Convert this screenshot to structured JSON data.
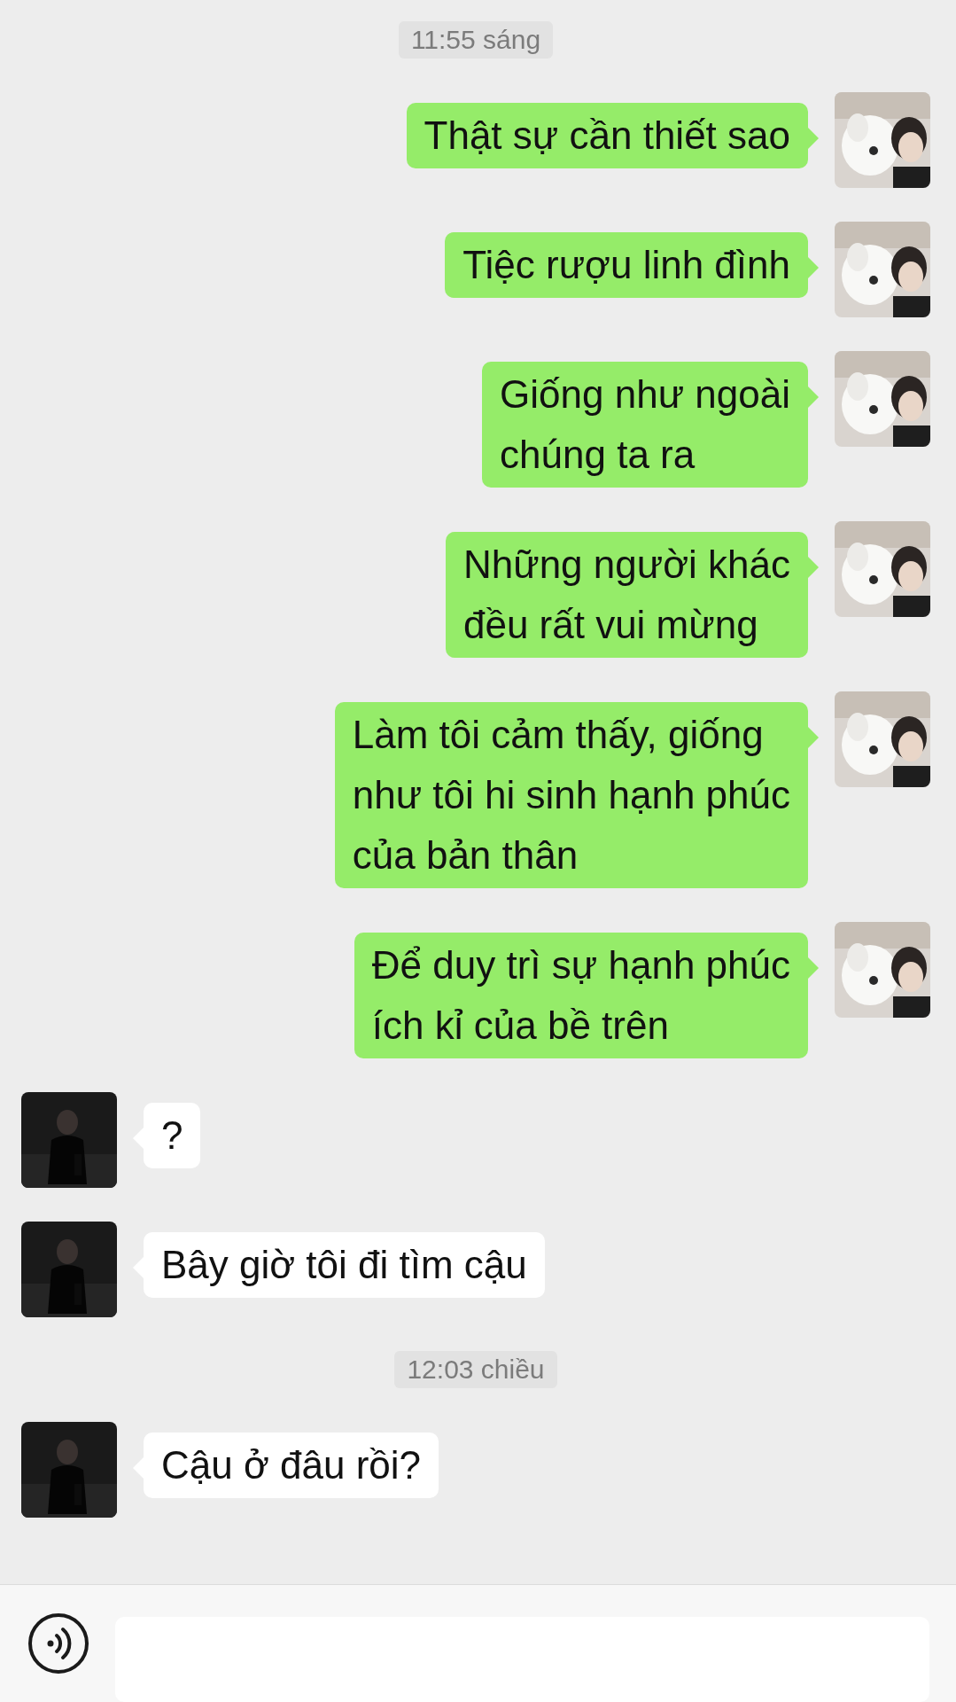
{
  "messages": [
    {
      "kind": "time",
      "text": "11:55 sáng"
    },
    {
      "kind": "message",
      "outgoing": true,
      "text": "Thật sự cần thiết sao"
    },
    {
      "kind": "message",
      "outgoing": true,
      "text": "Tiệc rượu linh đình"
    },
    {
      "kind": "message",
      "outgoing": true,
      "text": "Giống như ngoài\nchúng ta ra"
    },
    {
      "kind": "message",
      "outgoing": true,
      "text": "Những người khác\nđều rất vui mừng"
    },
    {
      "kind": "message",
      "outgoing": true,
      "text": "Làm tôi cảm thấy, giống\nnhư tôi hi sinh hạnh phúc\ncủa bản thân"
    },
    {
      "kind": "message",
      "outgoing": true,
      "text": "Để duy trì sự hạnh phúc\ních kỉ của bề trên"
    },
    {
      "kind": "message",
      "outgoing": false,
      "text": "?"
    },
    {
      "kind": "message",
      "outgoing": false,
      "text": "Bây giờ tôi đi tìm cậu"
    },
    {
      "kind": "time",
      "text": "12:03 chiều"
    },
    {
      "kind": "message",
      "outgoing": false,
      "text": "Cậu ở đâu rồi?"
    }
  ]
}
